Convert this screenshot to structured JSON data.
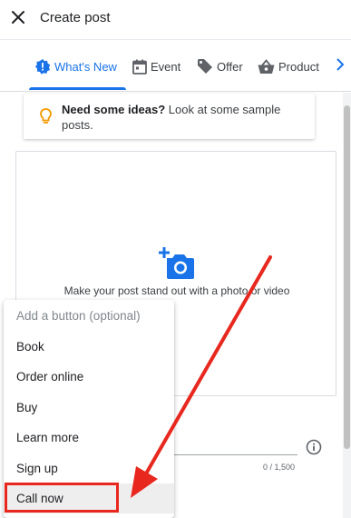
{
  "header": {
    "title": "Create post"
  },
  "tabs": [
    {
      "label": "What's New",
      "icon": "new-badge-icon",
      "active": true
    },
    {
      "label": "Event",
      "icon": "calendar-icon",
      "active": false
    },
    {
      "label": "Offer",
      "icon": "tag-icon",
      "active": false
    },
    {
      "label": "Product",
      "icon": "shopping-basket-icon",
      "active": false
    }
  ],
  "ideas": {
    "bold": "Need some ideas?",
    "text": " Look at some sample posts."
  },
  "photo": {
    "caption": "Make your post stand out with a photo or video"
  },
  "description": {
    "char_count": "0 / 1,500"
  },
  "button_dropdown": {
    "placeholder": "Add a button (optional)",
    "options": [
      "Book",
      "Order online",
      "Buy",
      "Learn more",
      "Sign up",
      "Call now"
    ],
    "selected": "Call now"
  },
  "colors": {
    "accent": "#1a73e8",
    "annotation_red": "#e8281e",
    "bulb": "#f29900"
  }
}
